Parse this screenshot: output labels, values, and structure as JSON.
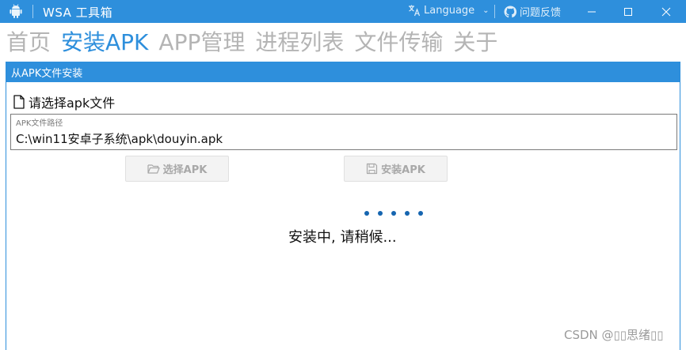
{
  "titlebar": {
    "app_title": "WSA 工具箱",
    "language_label": "Language",
    "feedback_label": "问题反馈",
    "icons": [
      "android-icon",
      "translate-icon",
      "chevron-down-icon",
      "github-icon",
      "minimize-icon",
      "maximize-icon",
      "close-icon"
    ]
  },
  "nav": {
    "tabs": [
      {
        "label": "首页"
      },
      {
        "label": "安装APK"
      },
      {
        "label": "APP管理"
      },
      {
        "label": "进程列表"
      },
      {
        "label": "文件传输"
      },
      {
        "label": "关于"
      }
    ],
    "active_tab": "安装APK"
  },
  "panel": {
    "header": "从APK文件安装",
    "prompt": "请选择apk文件",
    "field_caption": "APK文件路径",
    "field_value": "C:\\win11安卓子系统\\apk\\douyin.apk",
    "select_button": "选择APK",
    "install_button": "安装APK",
    "status": "安装中, 请稍候..."
  },
  "watermark": "CSDN @▯▯思绪▯▯",
  "colors": {
    "accent": "#2e8fdc",
    "inactive_tab": "#b4b4b4",
    "loading_dot": "#1565b0"
  }
}
